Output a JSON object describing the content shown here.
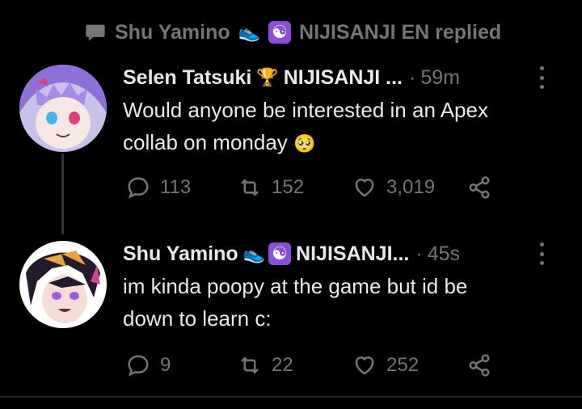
{
  "replied": {
    "name": "Shu Yamino",
    "badge_emoji": "👟",
    "badge_symbol": "☯",
    "text": "NIJISANJI EN replied"
  },
  "tweets": [
    {
      "name": "Selen Tatsuki",
      "badge_emoji": "🏆",
      "handle": "NIJISANJI ...",
      "time": "59m",
      "text_line1": "Would anyone be interested in an Apex",
      "text_line2": "collab on monday",
      "text_emoji": "🥺",
      "replies": "113",
      "retweets": "152",
      "likes": "3,019"
    },
    {
      "name": "Shu Yamino",
      "badge_emoji": "👟",
      "badge_symbol": "☯",
      "handle": "NIJISANJI...",
      "time": "45s",
      "text_line1": "im kinda poopy at the game but id be",
      "text_line2": "down to learn c:",
      "replies": "9",
      "retweets": "22",
      "likes": "252"
    }
  ],
  "colors": {
    "bg": "#000000",
    "text": "#e7e9ea",
    "muted": "#71767b",
    "line": "#333639"
  }
}
